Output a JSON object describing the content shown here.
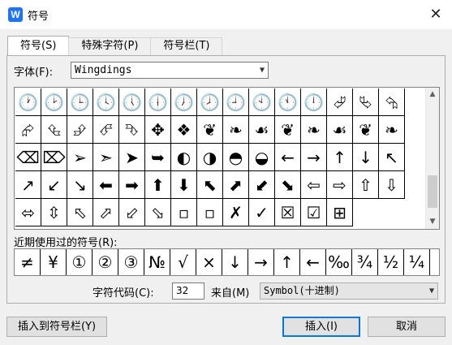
{
  "window": {
    "title": "符号",
    "app_icon": "W",
    "close_glyph": "✕"
  },
  "tabs": [
    {
      "label": "符号(S)",
      "active": true
    },
    {
      "label": "特殊字符(P)",
      "active": false
    },
    {
      "label": "符号栏(T)",
      "active": false
    }
  ],
  "font": {
    "label": "字体(F):",
    "value": "Wingdings"
  },
  "symbols": [
    "🕐",
    "🕑",
    "🕒",
    "🕓",
    "🕔",
    "🕕",
    "🕖",
    "🕗",
    "🕘",
    "🕙",
    "🕚",
    "🕛",
    "⮰",
    "⮱",
    "⮲",
    "⮳",
    "⮴",
    "⮵",
    "⮶",
    "⮷",
    "✥",
    "❖",
    "❦",
    "❧",
    "☙",
    "❦",
    "❧",
    "☙",
    "❦",
    "❧",
    "⌫",
    "⌦",
    "➢",
    "➣",
    "➤",
    "➥",
    "◐",
    "◑",
    "◓",
    "◒",
    "←",
    "→",
    "↑",
    "↓",
    "↖",
    "↗",
    "↙",
    "↘",
    "⬅",
    "➡",
    "⬆",
    "⬇",
    "⬉",
    "⬈",
    "⬋",
    "⬊",
    "⇦",
    "⇨",
    "⇧",
    "⇩",
    "⬄",
    "⇳",
    "⬁",
    "⬀",
    "⬃",
    "⬂",
    "▫",
    "▫",
    "✗",
    "✓",
    "☒",
    "☑",
    "⊞",
    "",
    ""
  ],
  "recent_label": "近期使用过的符号(R):",
  "recent": [
    "≠",
    "¥",
    "①",
    "②",
    "③",
    "№",
    "√",
    "×",
    "↓",
    "→",
    "↑",
    "←",
    "‰",
    "¾",
    "½",
    "¼"
  ],
  "char_code": {
    "label": "字符代码(C):",
    "value": "32"
  },
  "from": {
    "label": "来自(M)",
    "value": "Symbol(十进制)"
  },
  "buttons": {
    "insert_to_bar": "插入到符号栏(Y)",
    "insert": "插入(I)",
    "cancel": "取消"
  }
}
